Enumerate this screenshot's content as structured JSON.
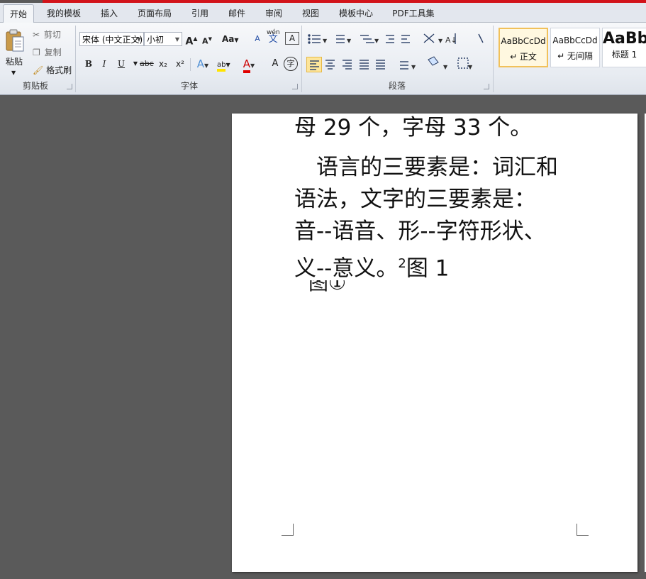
{
  "tabs": [
    "开始",
    "我的模板",
    "插入",
    "页面布局",
    "引用",
    "邮件",
    "审阅",
    "视图",
    "模板中心",
    "PDF工具集"
  ],
  "clipboard": {
    "paste": "粘贴",
    "cut": "剪切",
    "copy": "复制",
    "format_painter": "格式刷",
    "group_label": "剪贴板"
  },
  "font": {
    "font_name": "宋体 (中文正文)",
    "font_size": "小初",
    "group_label": "字体",
    "bold": "B",
    "italic": "I",
    "underline": "U",
    "strike": "abc",
    "subscript": "x₂",
    "superscript": "x²",
    "grow": "A",
    "shrink": "A",
    "change_case": "Aa",
    "clear": "A",
    "pinyin": "wén",
    "border": "A",
    "text_effect": "A",
    "highlight": "ab",
    "font_color": "A",
    "char_shade": "A",
    "enclose": "字"
  },
  "paragraph": {
    "group_label": "段落"
  },
  "styles": [
    {
      "sample": "AaBbCcDd",
      "name": "↵ 正文"
    },
    {
      "sample": "AaBbCcDd",
      "name": "↵ 无间隔"
    },
    {
      "sample": "AaBb",
      "name": "标题 1"
    }
  ],
  "document": {
    "line_top": "母 29 个，字母 33 个。",
    "para": [
      "　语言的三要素是：词汇和",
      "语法，文字的三要素是：",
      "音--语音、形--字符形状、",
      "义--意义。"
    ],
    "sup": "2",
    "fig": "图 1",
    "fig_cut": "图①"
  },
  "colors": {
    "accent_red": "#d2131a",
    "ribbon_bg": "#e8ecf2",
    "doc_bg": "#5a5a5a"
  }
}
